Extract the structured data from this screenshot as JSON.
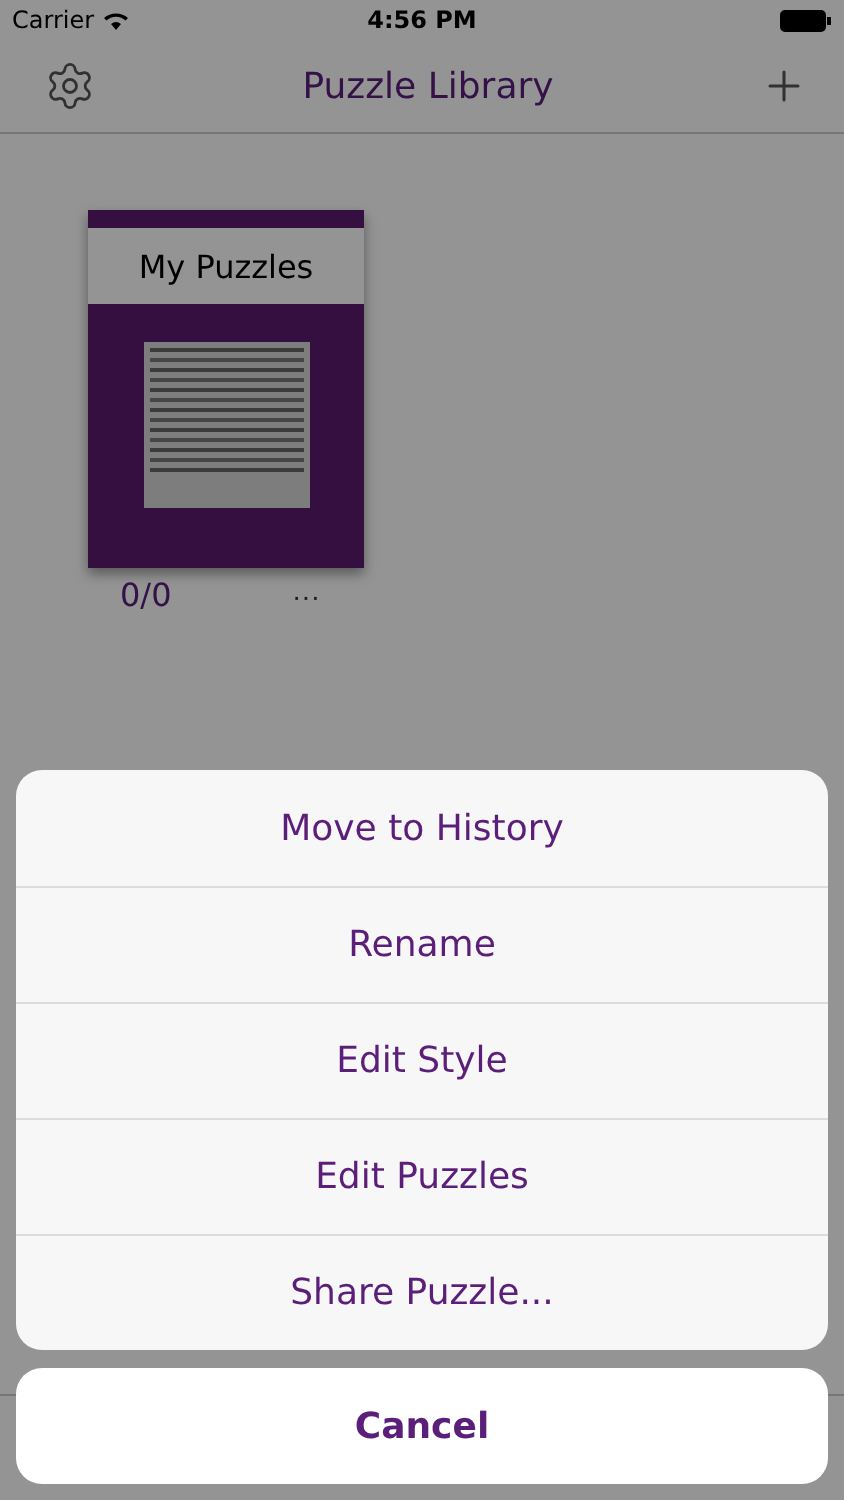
{
  "status_bar": {
    "carrier": "Carrier",
    "time": "4:56 PM"
  },
  "nav": {
    "title": "Puzzle Library"
  },
  "books": [
    {
      "title": "My Puzzles",
      "progress": "0/0",
      "more": "···"
    }
  ],
  "action_sheet": {
    "actions": [
      "Move to History",
      "Rename",
      "Edit Style",
      "Edit Puzzles",
      "Share Puzzle..."
    ],
    "cancel": "Cancel"
  }
}
